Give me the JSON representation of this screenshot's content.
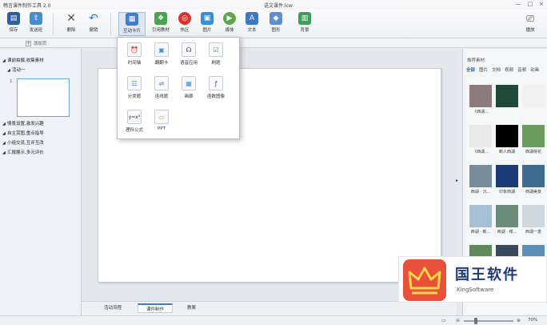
{
  "window": {
    "app_title": "畅言课件制作工具 2.0",
    "file_title": "语文课件.lcw",
    "controls": [
      "—",
      "□",
      "×"
    ]
  },
  "toolbar": {
    "save": {
      "label": "保存",
      "icon": "save-icon",
      "color": "#2b5f9e"
    },
    "send_class": {
      "label": "发送班",
      "icon": "send-icon",
      "color": "#4a8bd0"
    },
    "delete": {
      "label": "删除",
      "icon": "delete-icon",
      "color": "#555555"
    },
    "undo": {
      "label": "撤销",
      "icon": "undo-icon",
      "color": "#2f78c4"
    },
    "interactive_card": {
      "label": "互动卡片",
      "icon": "cards-icon",
      "color": "#3c7fcf"
    },
    "reference": {
      "label": "引用教材",
      "icon": "book-icon",
      "color": "#4aa34f"
    },
    "hotspot": {
      "label": "热区",
      "icon": "target-icon",
      "color": "#d9352c"
    },
    "picture": {
      "label": "图片",
      "icon": "image-icon",
      "color": "#3a8fd8"
    },
    "media": {
      "label": "媒体",
      "icon": "media-icon",
      "color": "#5da748"
    },
    "text": {
      "label": "文本",
      "icon": "text-icon",
      "color": "#3b78c9"
    },
    "shape": {
      "label": "图形",
      "icon": "shape-icon",
      "color": "#5f8fd0"
    },
    "background": {
      "label": "背景",
      "icon": "background-icon",
      "color": "#3da05a"
    },
    "playback": {
      "label": "播放",
      "icon": "play-icon",
      "color": "#444444"
    }
  },
  "secbar": {
    "add_page": "添加页"
  },
  "outline": [
    {
      "label": "课前拍摄,收集素材",
      "arrow": "◢"
    },
    {
      "label": "活动一",
      "arrow": "◢"
    },
    {
      "label": "情景设置,激发兴趣",
      "arrow": "◢"
    },
    {
      "label": "自主赏图,重点指导",
      "arrow": "◢"
    },
    {
      "label": "小组交流,互评互改",
      "arrow": "◢"
    },
    {
      "label": "汇报展示,多元评价",
      "arrow": "◢"
    }
  ],
  "thumbnail_number": "1",
  "bottom_tabs": [
    "活动流程",
    "课件制作",
    "教案"
  ],
  "active_tab": "课件制作",
  "popup_items": [
    {
      "label": "时间轴",
      "icon": "clock-icon",
      "glyph": "⏰",
      "color": "#d9352c"
    },
    {
      "label": "翻翻卡",
      "icon": "flip-card-icon",
      "glyph": "▣",
      "color": "#3a8fd8"
    },
    {
      "label": "语音应用",
      "icon": "headset-icon",
      "glyph": "☊",
      "color": "#444444"
    },
    {
      "label": "刷题",
      "icon": "quiz-icon",
      "glyph": "☑",
      "color": "#4aa34f"
    },
    {
      "label": "分类题",
      "icon": "classify-icon",
      "glyph": "☷",
      "color": "#3c7fcf"
    },
    {
      "label": "连线题",
      "icon": "link-line-icon",
      "glyph": "⇌",
      "color": "#4aa34f"
    },
    {
      "label": "画廊",
      "icon": "gallery-icon",
      "glyph": "▦",
      "color": "#3a8fd8"
    },
    {
      "label": "函数图像",
      "icon": "function-graph-icon",
      "glyph": "ƒ",
      "color": "#555555"
    },
    {
      "label": "理科公式",
      "icon": "formula-icon",
      "glyph": "y=x²",
      "color": "#333333"
    },
    {
      "label": "PPT",
      "icon": "ppt-icon",
      "glyph": "▭",
      "color": "#e0962a"
    }
  ],
  "materials": {
    "title": "推荐素材:",
    "tabs": [
      "全部",
      "图片",
      "文档",
      "视频",
      "音频",
      "动画"
    ],
    "active": "全部",
    "items": [
      {
        "label": "《西湖...",
        "color": "#8c7b7c"
      },
      {
        "label": "",
        "color": "#1f4a3a"
      },
      {
        "label": "",
        "color": "#f1f1f1"
      },
      {
        "label": "《西湖...",
        "color": "#e9e9e9"
      },
      {
        "label": "断人西湖",
        "color": "#000000"
      },
      {
        "label": "西湖荷花",
        "color": "#6b9a5f"
      },
      {
        "label": "西湖 · 沉...",
        "color": "#7a8c9a"
      },
      {
        "label": "印象西湖",
        "color": "#1b3c78"
      },
      {
        "label": "西湖美景",
        "color": "#3e6e8e"
      },
      {
        "label": "西湖 · 断...",
        "color": "#a5c0d4"
      },
      {
        "label": "西湖 · 缕...",
        "color": "#6a8c79"
      },
      {
        "label": "西湖一景",
        "color": "#cfd8de"
      },
      {
        "label": "",
        "color": "#5f8a5a"
      },
      {
        "label": "",
        "color": "#3a4a5a"
      },
      {
        "label": "雷远航",
        "color": "#5b8fb7"
      }
    ]
  },
  "status": {
    "zoom": "70%"
  },
  "watermark": {
    "name": "国王软件",
    "sub": "KingSoftware"
  }
}
